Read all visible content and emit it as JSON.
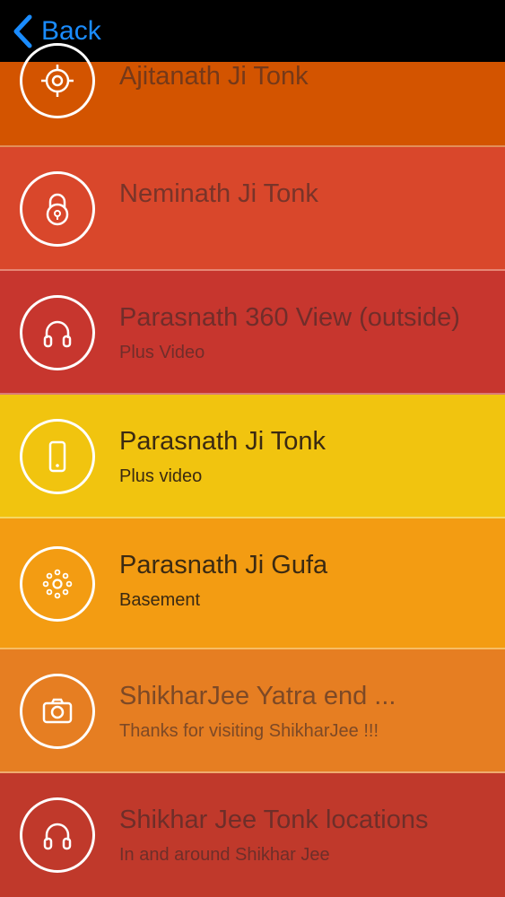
{
  "navbar": {
    "back_label": "Back",
    "back_icon": "chevron-left-icon",
    "accent_color": "#1a8cff"
  },
  "items": [
    {
      "title": "Ajitanath Ji Tonk",
      "subtitle": "",
      "icon": "target-icon",
      "color": "#d35400"
    },
    {
      "title": "Neminath Ji Tonk",
      "subtitle": "",
      "icon": "lock-icon",
      "color": "#d9472b"
    },
    {
      "title": "Parasnath 360 View (outside)",
      "subtitle": "Plus Video",
      "icon": "headphones-icon",
      "color": "#c7362e"
    },
    {
      "title": "Parasnath Ji Tonk",
      "subtitle": "Plus video",
      "icon": "phone-icon",
      "color": "#f1c40f"
    },
    {
      "title": "Parasnath Ji Gufa",
      "subtitle": "Basement",
      "icon": "dots-circle-icon",
      "color": "#f39c12"
    },
    {
      "title": "ShikharJee Yatra end ...",
      "subtitle": "Thanks for visiting ShikharJee !!!",
      "icon": "camera-icon",
      "color": "#e67e22"
    },
    {
      "title": "Shikhar Jee Tonk locations",
      "subtitle": "In and around Shikhar Jee",
      "icon": "headphones-icon",
      "color": "#c0392b"
    }
  ]
}
